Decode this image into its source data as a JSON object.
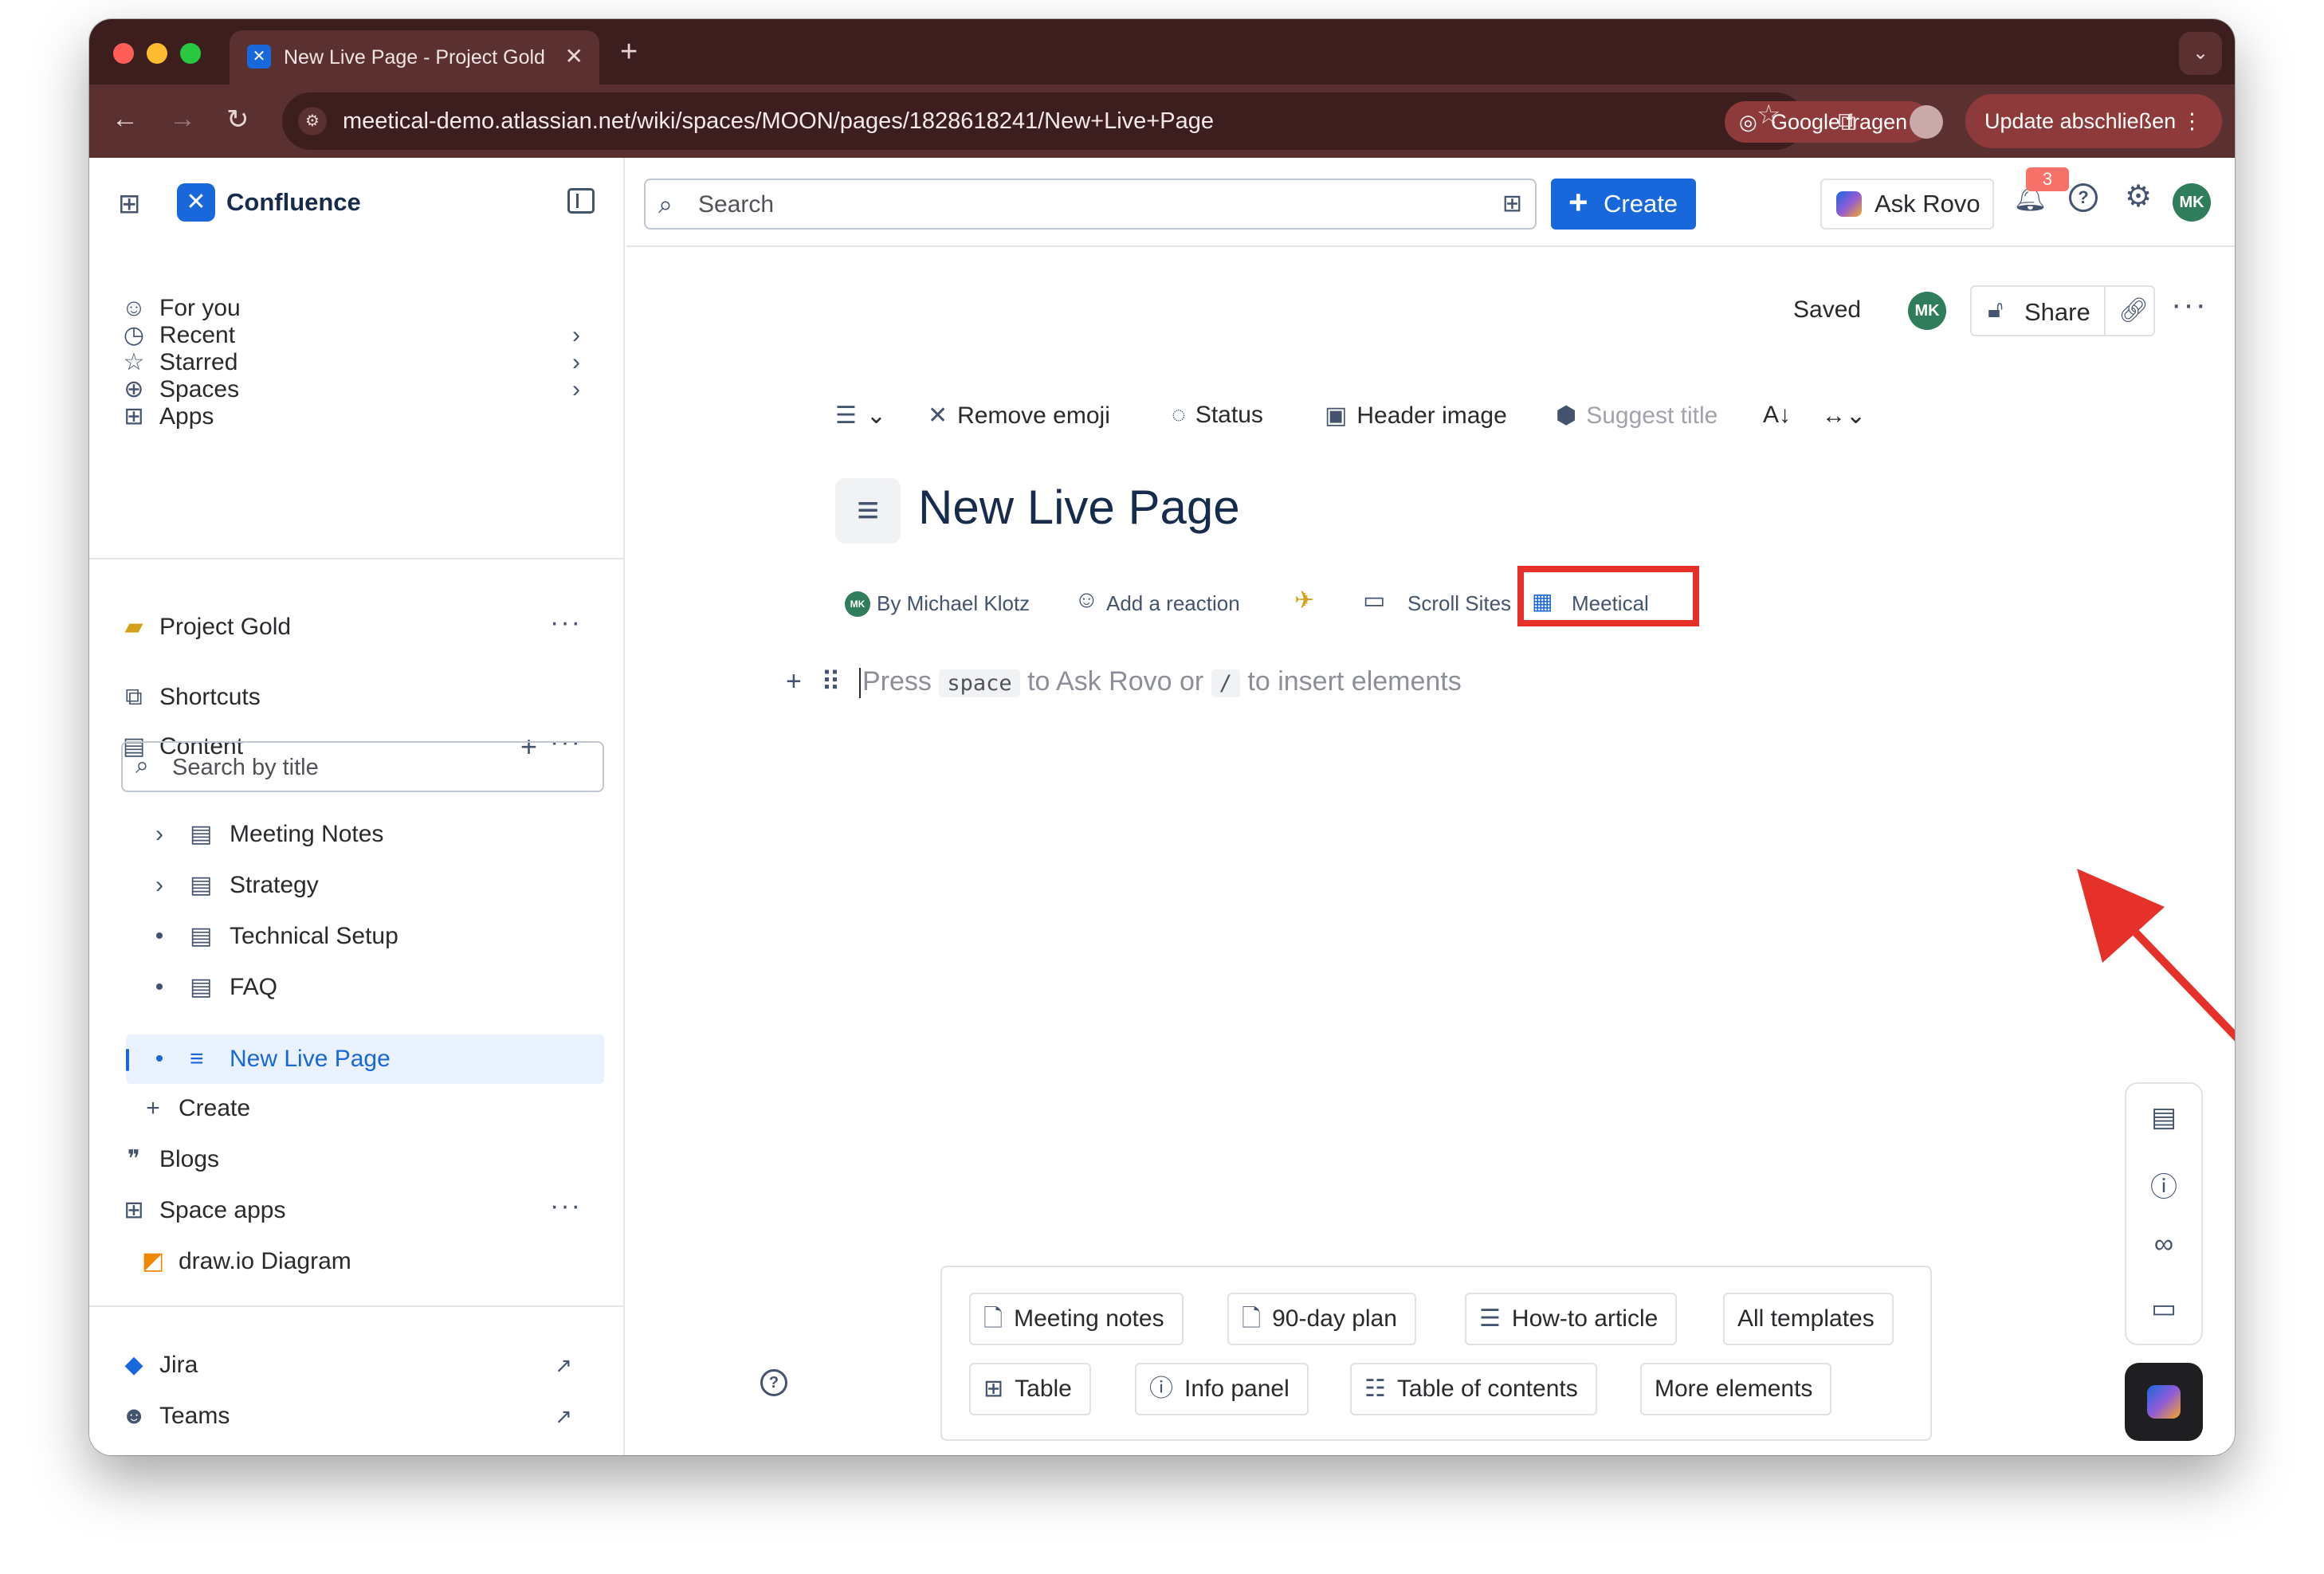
{
  "browser": {
    "tab_title": "New Live Page - Project Gold",
    "url": "meetical-demo.atlassian.net/wiki/spaces/MOON/pages/1828618241/New+Live+Page",
    "google_button": "Google fragen",
    "update_button": "Update abschließen"
  },
  "app": {
    "name": "Confluence",
    "search_placeholder": "Search",
    "create_label": "Create",
    "ask_rovo_label": "Ask Rovo",
    "notification_count": "3",
    "avatar_initials": "MK"
  },
  "sidebar": {
    "nav": [
      {
        "label": "For you"
      },
      {
        "label": "Recent"
      },
      {
        "label": "Starred"
      },
      {
        "label": "Spaces"
      },
      {
        "label": "Apps"
      }
    ],
    "space_name": "Project Gold",
    "shortcuts_label": "Shortcuts",
    "content_label": "Content",
    "search_placeholder": "Search by title",
    "tree": [
      {
        "label": "Meeting Notes"
      },
      {
        "label": "Strategy"
      },
      {
        "label": "Technical Setup"
      },
      {
        "label": "FAQ"
      },
      {
        "label": "New Live Page"
      }
    ],
    "create_label": "Create",
    "blogs_label": "Blogs",
    "space_apps_label": "Space apps",
    "drawio_label": "draw.io Diagram",
    "jira_label": "Jira",
    "teams_label": "Teams"
  },
  "page": {
    "saved_label": "Saved",
    "share_label": "Share",
    "toolbar": {
      "remove_emoji": "Remove emoji",
      "status": "Status",
      "header_image": "Header image",
      "suggest_title": "Suggest title"
    },
    "title": "New Live Page",
    "byline": {
      "author": "By Michael Klotz",
      "reaction": "Add a reaction",
      "scroll_sites": "Scroll Sites",
      "meetical": "Meetical"
    },
    "editor": {
      "part1": "Press",
      "key1": "space",
      "part2": "to Ask Rovo or",
      "key2": "/",
      "part3": "to insert elements"
    },
    "templates": [
      {
        "label": "Meeting notes"
      },
      {
        "label": "90-day plan"
      },
      {
        "label": "How-to article"
      },
      {
        "label": "All templates"
      },
      {
        "label": "Table"
      },
      {
        "label": "Info panel"
      },
      {
        "label": "Table of contents"
      },
      {
        "label": "More elements"
      }
    ]
  },
  "colors": {
    "accent": "#1868db",
    "highlight": "#e5312a",
    "titlebar": "#3c1e1e"
  }
}
